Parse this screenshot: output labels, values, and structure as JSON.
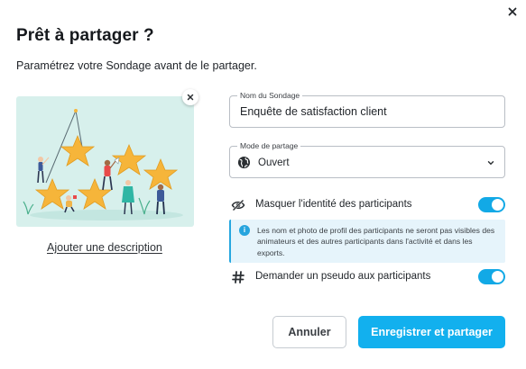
{
  "dialog": {
    "title": "Prêt à partager ?",
    "subtitle": "Paramétrez votre Sondage avant de le partager."
  },
  "illustration": {
    "add_description": "Ajouter une description"
  },
  "form": {
    "name_legend": "Nom du Sondage",
    "name_value": "Enquête de satisfaction client",
    "mode_legend": "Mode de partage",
    "mode_value": "Ouvert"
  },
  "options": {
    "anonymize_label": "Masquer l'identité des participants",
    "anonymize_on": true,
    "info_text": "Les nom et photo de profil des participants ne seront pas visibles des animateurs et des autres participants dans l'activité et dans les exports.",
    "pseudo_label": "Demander un pseudo aux participants",
    "pseudo_on": true
  },
  "buttons": {
    "cancel": "Annuler",
    "save_share": "Enregistrer et partager"
  },
  "colors": {
    "accent": "#12b0ee",
    "info_bg": "#e6f4fb",
    "illustration_bg": "#d7f0ec",
    "star": "#f6b53a"
  },
  "icons": {
    "close": "close-icon",
    "image_remove": "close-icon",
    "mode": "globe-icon",
    "dropdown": "chevron-down-icon",
    "anonymize": "eye-slash-icon",
    "info": "info-icon",
    "pseudo": "hashtag-icon"
  }
}
